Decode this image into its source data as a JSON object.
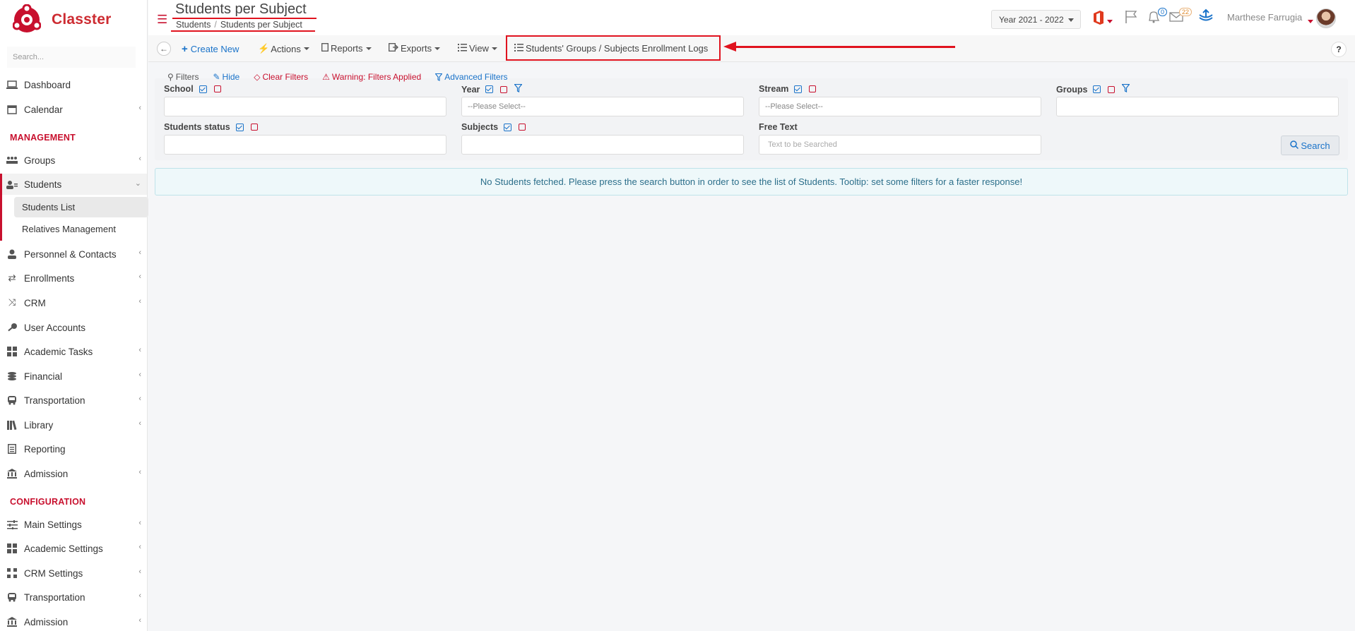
{
  "app": {
    "name": "Classter"
  },
  "sidebar": {
    "search_placeholder": "Search...",
    "sections": {
      "management": "MANAGEMENT",
      "configuration": "CONFIGURATION"
    },
    "items": {
      "dashboard": "Dashboard",
      "calendar": "Calendar",
      "groups": "Groups",
      "students": "Students",
      "students_list": "Students List",
      "relatives": "Relatives Management",
      "personnel": "Personnel & Contacts",
      "enrollments": "Enrollments",
      "crm": "CRM",
      "user_accounts": "User Accounts",
      "academic_tasks": "Academic Tasks",
      "financial": "Financial",
      "transportation": "Transportation",
      "library": "Library",
      "reporting": "Reporting",
      "admission": "Admission",
      "main_settings": "Main Settings",
      "academic_settings": "Academic Settings",
      "crm_settings": "CRM Settings",
      "transportation2": "Transportation",
      "admission2": "Admission"
    }
  },
  "header": {
    "title": "Students per Subject",
    "breadcrumb": [
      "Students",
      "Students per Subject"
    ],
    "year": "Year 2021 - 2022",
    "notifications_count": "0",
    "messages_count": "22",
    "user_name": "Marthese Farrugia"
  },
  "toolbar": {
    "create_new": "Create New",
    "actions": "Actions",
    "reports": "Reports",
    "exports": "Exports",
    "view": "View",
    "enrollment_logs": "Students' Groups / Subjects Enrollment Logs",
    "help": "?"
  },
  "filters": {
    "bar": {
      "filters": "Filters",
      "hide": "Hide",
      "clear": "Clear Filters",
      "warning": "Warning: Filters Applied",
      "advanced": "Advanced Filters"
    },
    "school": {
      "label": "School",
      "value": ""
    },
    "year": {
      "label": "Year",
      "placeholder": "--Please Select--"
    },
    "stream": {
      "label": "Stream",
      "placeholder": "--Please Select--"
    },
    "groups": {
      "label": "Groups",
      "value": ""
    },
    "students_status": {
      "label": "Students status",
      "value": ""
    },
    "subjects": {
      "label": "Subjects",
      "value": ""
    },
    "free_text": {
      "label": "Free Text",
      "placeholder": "Text to be Searched"
    },
    "search_button": "Search"
  },
  "message": "No Students fetched. Please press the search button in order to see the list of Students. Tooltip: set some filters for a faster response!",
  "colors": {
    "brand": "#c8102e",
    "link": "#1a73c9",
    "highlight": "#e0131f"
  }
}
